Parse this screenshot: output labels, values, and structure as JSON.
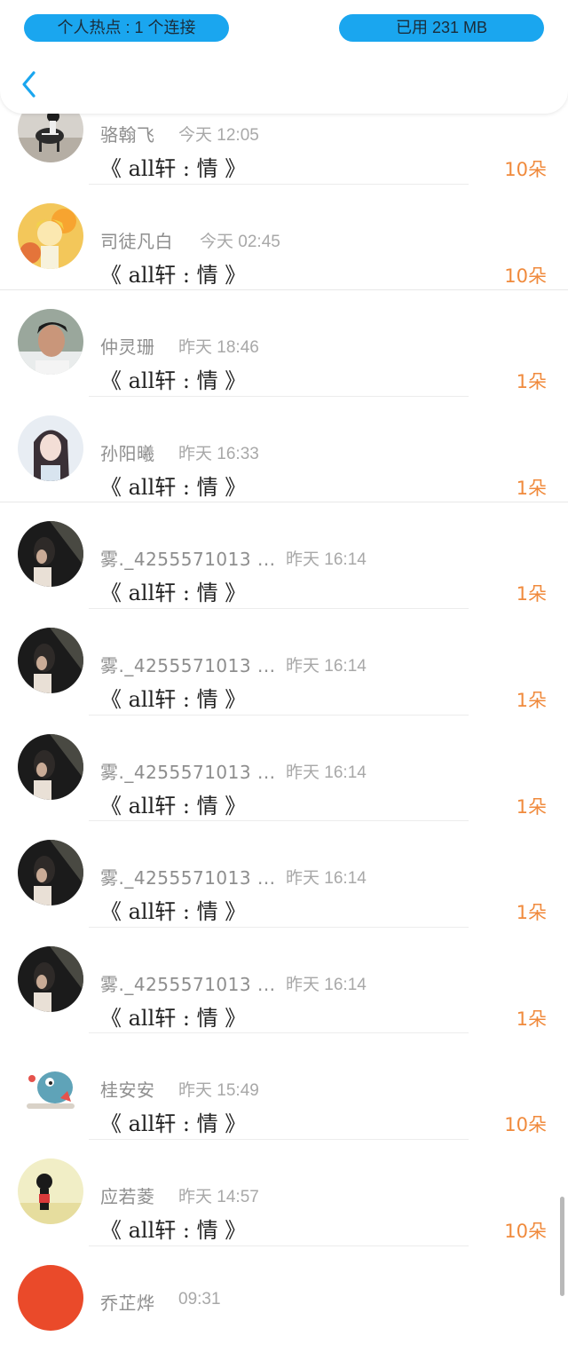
{
  "status": {
    "hotspot": "个人热点 : 1 个连接",
    "data_used": "已用 231 MB"
  },
  "nav": {
    "back_icon": "chevron-left-icon"
  },
  "colors": {
    "accent_blue": "#1aa6ef",
    "count_orange": "#f08a3c"
  },
  "list": [
    {
      "name": "骆翰飞",
      "time": "今天 12:05",
      "title": "《 all轩 : 情 》",
      "count": "10朵",
      "avatar": "zebra-rider"
    },
    {
      "name": "司徒凡白",
      "time": "今天 02:45",
      "title": "《 all轩 : 情 》",
      "count": "10朵",
      "avatar": "anime-blonde"
    },
    {
      "name": "仲灵珊",
      "time": "昨天 18:46",
      "title": "《 all轩 : 情 》",
      "count": "1朵",
      "avatar": "young-man"
    },
    {
      "name": "孙阳曦",
      "time": "昨天 16:33",
      "title": "《 all轩 : 情 》",
      "count": "1朵",
      "avatar": "anime-girl"
    },
    {
      "name": "雾._4255571013 ...",
      "time": "昨天 16:14",
      "title": "《 all轩 : 情 》",
      "count": "1朵",
      "avatar": "dark-portrait"
    },
    {
      "name": "雾._4255571013 ...",
      "time": "昨天 16:14",
      "title": "《 all轩 : 情 》",
      "count": "1朵",
      "avatar": "dark-portrait"
    },
    {
      "name": "雾._4255571013 ...",
      "time": "昨天 16:14",
      "title": "《 all轩 : 情 》",
      "count": "1朵",
      "avatar": "dark-portrait"
    },
    {
      "name": "雾._4255571013 ...",
      "time": "昨天 16:14",
      "title": "《 all轩 : 情 》",
      "count": "1朵",
      "avatar": "dark-portrait"
    },
    {
      "name": "雾._4255571013 ...",
      "time": "昨天 16:14",
      "title": "《 all轩 : 情 》",
      "count": "1朵",
      "avatar": "dark-portrait"
    },
    {
      "name": "桂安安",
      "time": "昨天 15:49",
      "title": "《 all轩 : 情 》",
      "count": "10朵",
      "avatar": "cartoon-monster"
    },
    {
      "name": "应若菱",
      "time": "昨天 14:57",
      "title": "《 all轩 : 情 》",
      "count": "10朵",
      "avatar": "silhouette-girl"
    },
    {
      "name": "乔芷烨",
      "time": "09:31",
      "title": "",
      "count": "",
      "avatar": "red-circle"
    }
  ]
}
